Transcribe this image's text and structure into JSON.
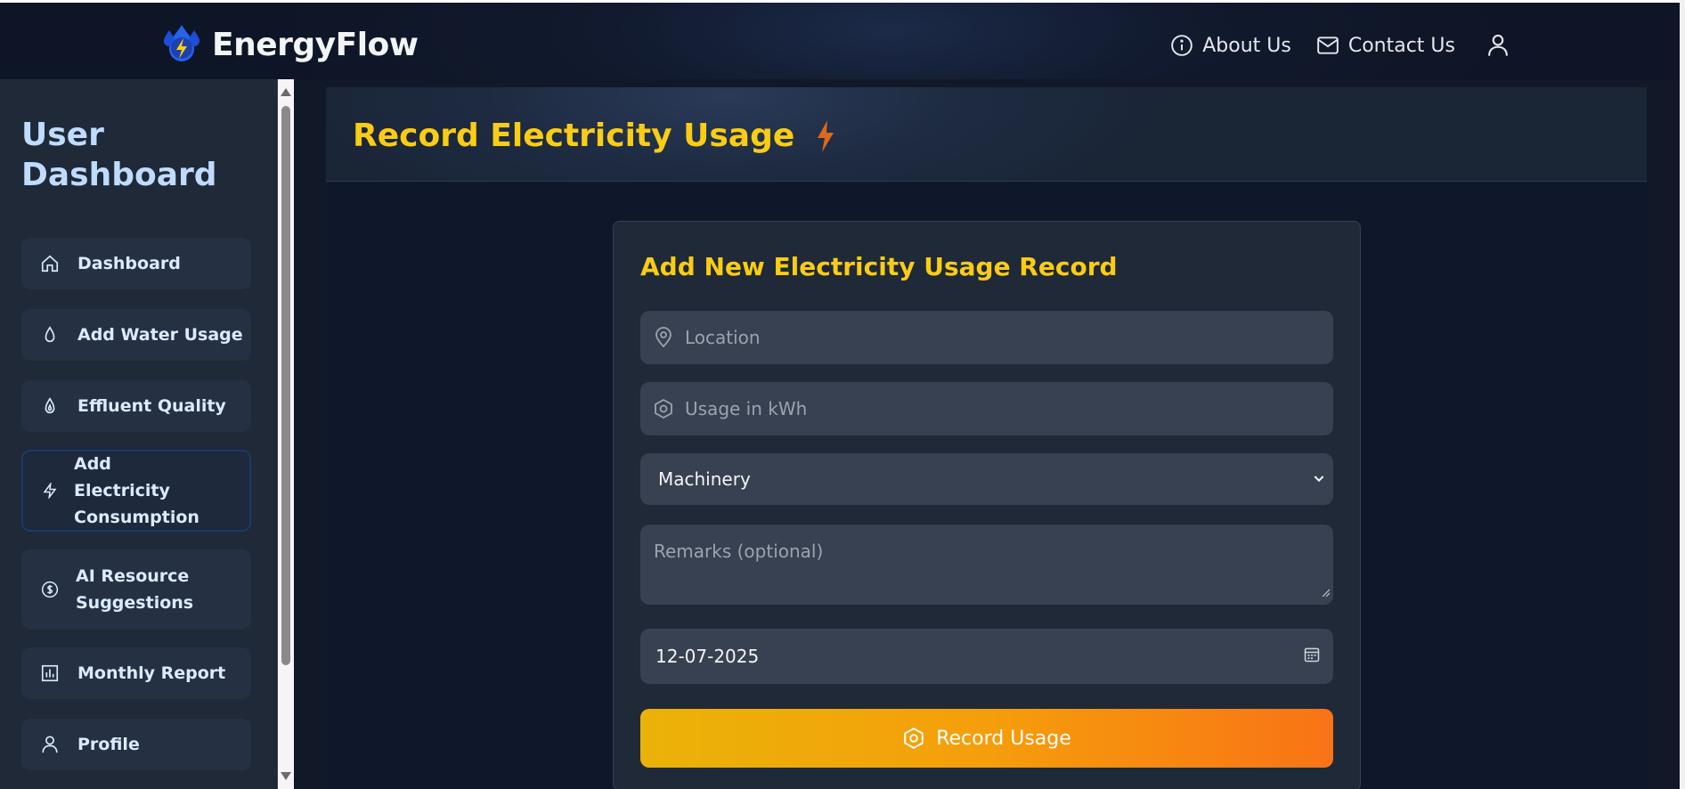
{
  "brand": {
    "name": "EnergyFlow",
    "logo_icon": "water-bolt-logo"
  },
  "topnav": {
    "about_label": "About Us",
    "contact_label": "Contact Us"
  },
  "sidebar": {
    "title": "User Dashboard",
    "items": [
      {
        "label": "Dashboard",
        "icon": "home-icon"
      },
      {
        "label": "Add Water Usage",
        "icon": "droplet-icon"
      },
      {
        "label": "Effluent Quality",
        "icon": "flame-drop-icon"
      },
      {
        "label": "Add Electricity Consumption",
        "icon": "bolt-icon",
        "active": true
      },
      {
        "label": "AI Resource Suggestions",
        "icon": "dollar-circle-icon"
      },
      {
        "label": "Monthly Report",
        "icon": "bar-chart-icon"
      },
      {
        "label": "Profile",
        "icon": "user-icon"
      }
    ]
  },
  "page": {
    "title": "Record Electricity Usage"
  },
  "form": {
    "title": "Add New Electricity Usage Record",
    "location_placeholder": "Location",
    "usage_placeholder": "Usage in kWh",
    "category_selected": "Machinery",
    "remarks_placeholder": "Remarks (optional)",
    "date_value": "12-07-2025",
    "submit_label": "Record Usage"
  },
  "colors": {
    "accent": "#facc15",
    "button_start": "#eab308",
    "button_end": "#f97316",
    "sidebar_text": "#dbeafe"
  }
}
